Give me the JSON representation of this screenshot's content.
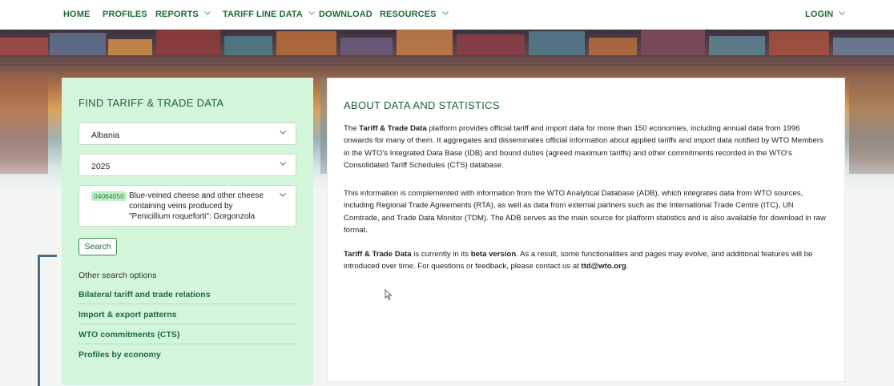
{
  "nav": {
    "home": "HOME",
    "profiles": "PROFILES",
    "reports": "REPORTS",
    "tariff_line_data": "TARIFF LINE DATA",
    "download": "DOWNLOAD",
    "resources": "RESOURCES",
    "login": "LOGIN"
  },
  "find_panel": {
    "title": "FIND TARIFF & TRADE DATA",
    "economy": "Albania",
    "year": "2025",
    "product_code": "04064050",
    "product_description": "Blue-veined cheese and other cheese containing veins produced by \"Penicillium roqueforti\": Gorgonzola",
    "search_label": "Search",
    "other_title": "Other search options",
    "options": [
      "Bilateral tariff and trade relations",
      "Import & export patterns",
      "WTO commitments (CTS)",
      "Profiles by economy"
    ]
  },
  "about": {
    "title": "ABOUT DATA AND STATISTICS",
    "p1": {
      "pre": "The ",
      "bold": "Tariff & Trade Data",
      "post": " platform provides official tariff and import data for more than 150 economies, including annual data from 1996 onwards for many of them. It aggregates and disseminates official information about applied tariffs and import data notified by WTO Members in the WTO's Integrated Data Base (IDB) and bound duties (agreed maximum tariffs) and other commitments recorded in the WTO's Consolidated Tariff Schedules (CTS) database."
    },
    "p2": "This information is complemented with information from the WTO Analytical Database (ADB), which integrates data from WTO sources, including Regional Trade Agreements (RTA), as well as data from external partners such as the International Trade Centre (ITC), UN Comtrade, and Trade Data Monitor (TDM). The ADB serves as the main source for platform statistics and is also available for download in raw format.",
    "p3": {
      "bold1": "Tariff & Trade Data",
      "mid1": " is currently in its ",
      "bold2": "beta version",
      "mid2": ". As a result, some functionalities and pages may evolve, and additional features will be introduced over time. For questions or feedback, please contact us at ",
      "email": "ttd@wto.org",
      "end": "."
    }
  },
  "colors": {
    "nav_text": "#1d6a3a",
    "panel_bg": "#d3f6db",
    "title_green": "#1f5e34"
  }
}
